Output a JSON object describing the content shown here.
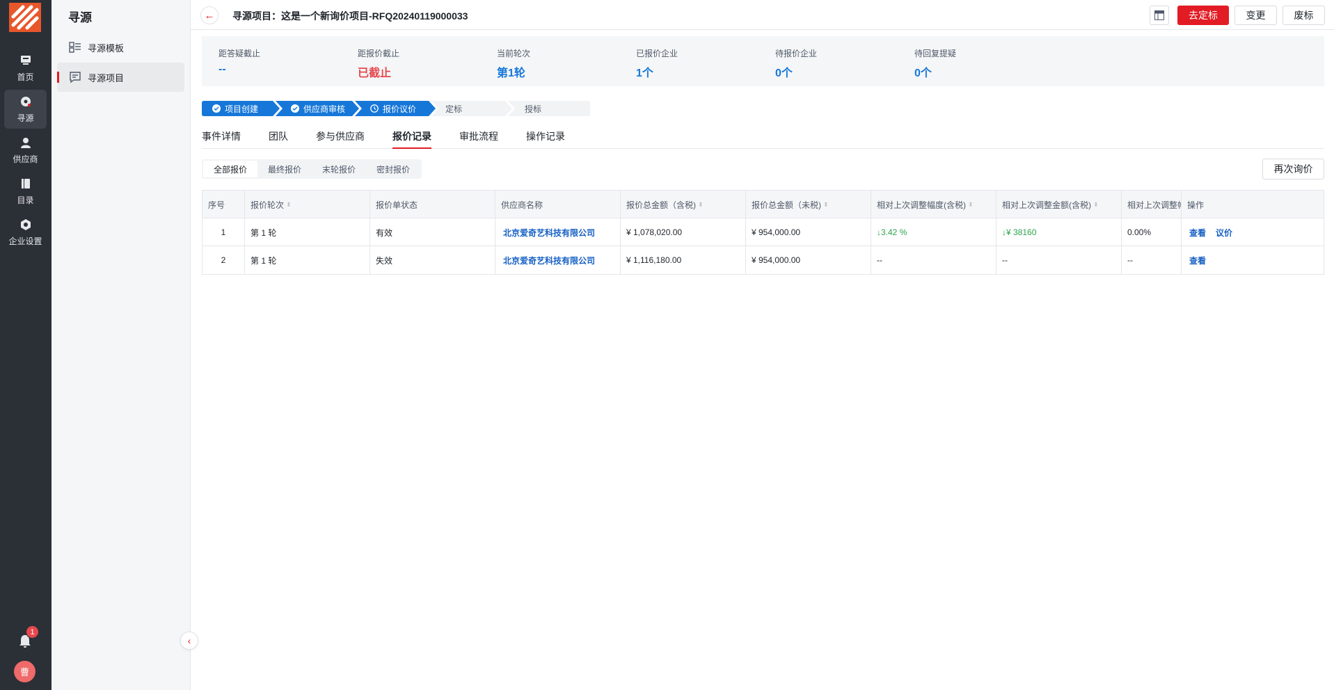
{
  "colors": {
    "brand": "#e21c24",
    "rail_bg": "#2b2f36",
    "stat_blue": "#1677d9",
    "stat_red": "#e5484d",
    "step_blue": "#1677d9",
    "link": "#1660c4",
    "green": "#2ba44e"
  },
  "rail": {
    "items": [
      {
        "label": "首页",
        "icon": "home-icon"
      },
      {
        "label": "寻源",
        "icon": "sourcing-icon"
      },
      {
        "label": "供应商",
        "icon": "supplier-icon"
      },
      {
        "label": "目录",
        "icon": "catalog-icon"
      },
      {
        "label": "企业设置",
        "icon": "settings-icon"
      }
    ],
    "notification_count": "1",
    "avatar_text": "曹"
  },
  "subnav": {
    "title": "寻源",
    "items": [
      {
        "label": "寻源模板",
        "icon": "template-icon"
      },
      {
        "label": "寻源项目",
        "icon": "project-icon"
      }
    ]
  },
  "header": {
    "title": "寻源项目：这是一个新询价项目-RFQ20240119000033",
    "btn_award": "去定标",
    "btn_change": "变更",
    "btn_abandon": "废标"
  },
  "stats": [
    {
      "label": "距答疑截止",
      "value": "--"
    },
    {
      "label": "距报价截止",
      "value": "已截止"
    },
    {
      "label": "当前轮次",
      "value": "第1轮"
    },
    {
      "label": "已报价企业",
      "value": "1个"
    },
    {
      "label": "待报价企业",
      "value": "0个"
    },
    {
      "label": "待回复提疑",
      "value": "0个"
    }
  ],
  "steps": [
    {
      "label": "项目创建",
      "status": "done"
    },
    {
      "label": "供应商审核",
      "status": "done"
    },
    {
      "label": "报价议价",
      "status": "current"
    },
    {
      "label": "定标",
      "status": "todo"
    },
    {
      "label": "授标",
      "status": "todo"
    }
  ],
  "tabs": [
    "事件详情",
    "团队",
    "参与供应商",
    "报价记录",
    "审批流程",
    "操作记录"
  ],
  "subtabs": [
    "全部报价",
    "最终报价",
    "末轮报价",
    "密封报价"
  ],
  "reinquire": "再次询价",
  "table": {
    "headers": [
      "序号",
      "报价轮次",
      "报价单状态",
      "供应商名称",
      "报价总金额（含税)",
      "报价总金额（未税)",
      "相对上次调整幅度(含税)",
      "相对上次调整金额(含税)",
      "相对上次调整幅",
      "操作"
    ],
    "rows": [
      {
        "no": "1",
        "round": "第 1 轮",
        "status": "有效",
        "supplier": "北京爱奇艺科技有限公司",
        "total_tax": "¥ 1,078,020.00",
        "total_notax": "¥ 954,000.00",
        "adj_pct": "↓3.42 %",
        "adj_amt": "↓¥ 38160",
        "adj_other": "0.00%",
        "ops": [
          "查看",
          "议价"
        ]
      },
      {
        "no": "2",
        "round": "第 1 轮",
        "status": "失效",
        "supplier": "北京爱奇艺科技有限公司",
        "total_tax": "¥ 1,116,180.00",
        "total_notax": "¥ 954,000.00",
        "adj_pct": "--",
        "adj_amt": "--",
        "adj_other": "--",
        "ops": [
          "查看"
        ]
      }
    ]
  }
}
